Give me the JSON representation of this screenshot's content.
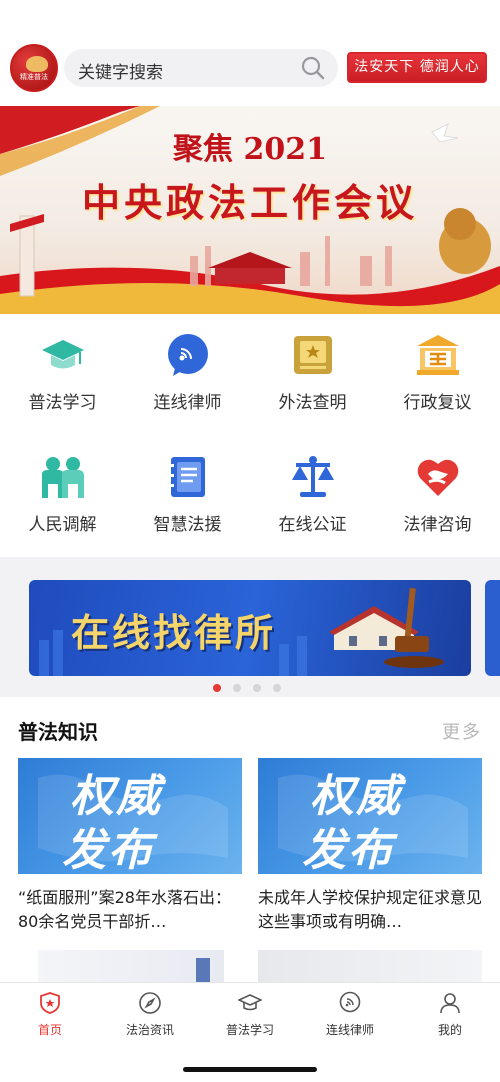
{
  "header": {
    "logo_text": "精准普法",
    "search_placeholder": "关键字搜索",
    "slogan": "法安天下 德润人心"
  },
  "banner": {
    "title_top": "聚焦 2021",
    "title_main": "中央政法工作会议"
  },
  "grid": {
    "items": [
      {
        "label": "普法学习",
        "icon": "graduation-cap-icon"
      },
      {
        "label": "连线律师",
        "icon": "chat-bubble-icon"
      },
      {
        "label": "外法查明",
        "icon": "law-book-icon"
      },
      {
        "label": "行政复议",
        "icon": "courthouse-icon"
      },
      {
        "label": "人民调解",
        "icon": "people-icon"
      },
      {
        "label": "智慧法援",
        "icon": "notebook-icon"
      },
      {
        "label": "在线公证",
        "icon": "scales-icon"
      },
      {
        "label": "法律咨询",
        "icon": "shield-heart-icon"
      }
    ]
  },
  "promo": {
    "text": "在线找律所",
    "dots": 4,
    "active_dot": 0
  },
  "knowledge": {
    "title": "普法知识",
    "more": "更多",
    "cards": [
      {
        "image_line1": "权威",
        "image_line2": "发布",
        "title": "“纸面服刑”案28年水落石出：80余名党员干部折…"
      },
      {
        "image_line1": "权威",
        "image_line2": "发布",
        "title": "未成年人学校保护规定征求意见 这些事项或有明确…"
      }
    ]
  },
  "tabbar": {
    "tabs": [
      {
        "label": "首页",
        "icon": "home-shield-icon",
        "active": true
      },
      {
        "label": "法治资讯",
        "icon": "compass-icon",
        "active": false
      },
      {
        "label": "普法学习",
        "icon": "graduation-cap-icon",
        "active": false
      },
      {
        "label": "连线律师",
        "icon": "chat-bubble-icon",
        "active": false
      },
      {
        "label": "我的",
        "icon": "user-icon",
        "active": false
      }
    ]
  },
  "colors": {
    "accent_red": "#e53935",
    "teal": "#2fb8a2",
    "blue": "#2f67d8",
    "gold": "#f0b428"
  }
}
